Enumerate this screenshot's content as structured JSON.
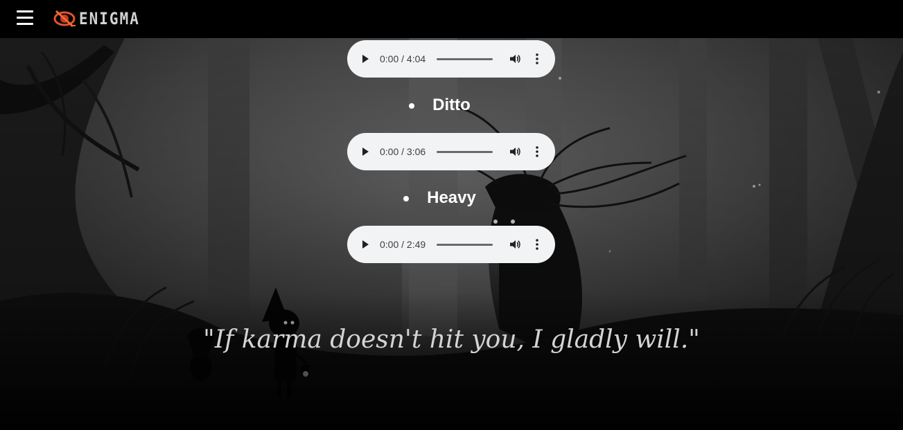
{
  "header": {
    "menu_icon": "hamburger-menu-icon",
    "logo_text": "ENIGMA",
    "logo_icon": "eye-logo-icon"
  },
  "music_list": {
    "tracks": [
      {
        "title": "",
        "time": "0:00 / 4:04"
      },
      {
        "title": "Ditto",
        "time": "0:00 / 3:06"
      },
      {
        "title": "Heavy",
        "time": "0:00 / 2:49"
      }
    ],
    "player_icons": {
      "play": "play-icon",
      "volume": "volume-icon",
      "more": "more-options-icon"
    }
  },
  "quote": {
    "text": "\"If karma doesn't hit you, I gladly will.\""
  },
  "colors": {
    "header_bg": "#000000",
    "player_bg": "#f1f3f4",
    "title_text": "#ffffff",
    "quote_text": "#d4d4d4"
  }
}
